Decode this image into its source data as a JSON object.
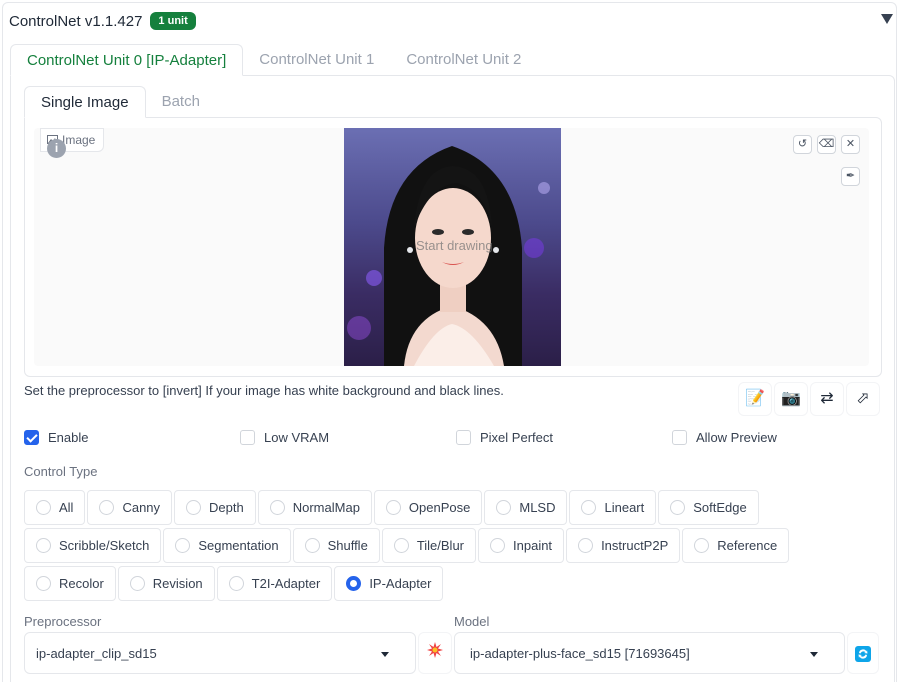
{
  "header": {
    "title": "ControlNet v1.1.427",
    "badge": "1 unit"
  },
  "unit_tabs": [
    {
      "label": "ControlNet Unit 0 [IP-Adapter]",
      "active": true
    },
    {
      "label": "ControlNet Unit 1",
      "active": false
    },
    {
      "label": "ControlNet Unit 2",
      "active": false
    }
  ],
  "image_tabs": [
    {
      "label": "Single Image",
      "active": true
    },
    {
      "label": "Batch",
      "active": false
    }
  ],
  "image_panel": {
    "label": "Image",
    "info_glyph": "i",
    "canvas_watermark": "Start drawing",
    "icons": [
      "undo-icon",
      "eraser-icon",
      "close-icon",
      "brush-icon"
    ]
  },
  "hint": "Set the preprocessor to [invert] If your image has white background and black lines.",
  "tool_icons": [
    "edit-icon",
    "camera-icon",
    "swap-icon",
    "send-icon"
  ],
  "checkboxes": [
    {
      "label": "Enable",
      "checked": true
    },
    {
      "label": "Low VRAM",
      "checked": false
    },
    {
      "label": "Pixel Perfect",
      "checked": false
    },
    {
      "label": "Allow Preview",
      "checked": false
    }
  ],
  "control_type": {
    "label": "Control Type",
    "rows": [
      [
        "All",
        "Canny",
        "Depth",
        "NormalMap",
        "OpenPose",
        "MLSD",
        "Lineart",
        "SoftEdge"
      ],
      [
        "Scribble/Sketch",
        "Segmentation",
        "Shuffle",
        "Tile/Blur",
        "Inpaint",
        "InstructP2P",
        "Reference"
      ],
      [
        "Recolor",
        "Revision",
        "T2I-Adapter",
        "IP-Adapter"
      ]
    ],
    "selected": "IP-Adapter"
  },
  "preprocessor": {
    "label": "Preprocessor",
    "value": "ip-adapter_clip_sd15"
  },
  "model": {
    "label": "Model",
    "value": "ip-adapter-plus-face_sd15 [71693645]"
  },
  "colors": {
    "accent_green": "#15803d",
    "accent_blue": "#2563eb",
    "run_icon": "#ef4444"
  }
}
